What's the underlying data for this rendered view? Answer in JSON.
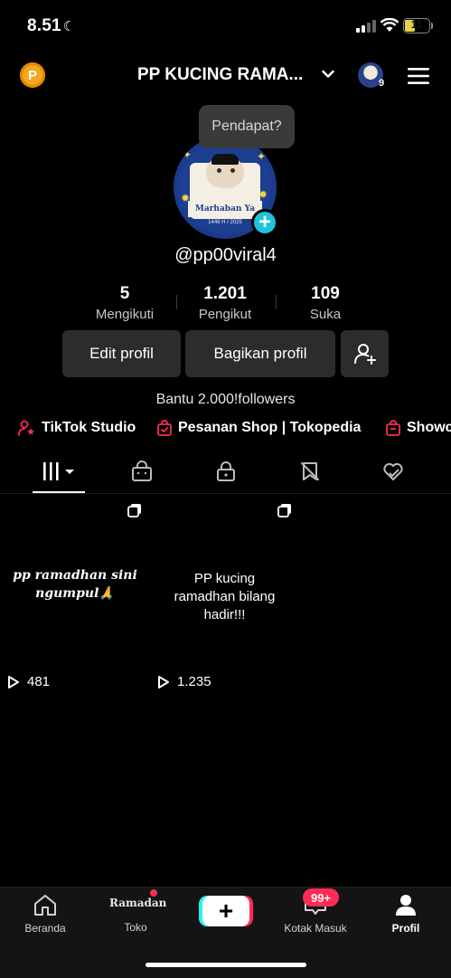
{
  "status_bar": {
    "time": "8.51",
    "battery": "11"
  },
  "header": {
    "title": "PP KUCING RAMA...",
    "coin_label": "P",
    "notification_count": "9"
  },
  "tooltip": "Pendapat?",
  "avatar": {
    "banner": "Marhaban Ya Ramadhan",
    "sub": "1446 H / 2025"
  },
  "profile": {
    "username": "@pp00viral4",
    "bio": "Bantu 2.000!followers"
  },
  "stats": [
    {
      "value": "5",
      "label": "Mengikuti"
    },
    {
      "value": "1.201",
      "label": "Pengikut"
    },
    {
      "value": "109",
      "label": "Suka"
    }
  ],
  "buttons": {
    "edit": "Edit profil",
    "share": "Bagikan profil"
  },
  "links": [
    {
      "label": "TikTok Studio",
      "icon": "person-star-icon"
    },
    {
      "label": "Pesanan Shop | Tokopedia",
      "icon": "shopping-bag-check-icon"
    },
    {
      "label": "Showcase",
      "icon": "shopping-bag-icon"
    }
  ],
  "tabs": [
    "grid-icon",
    "shop-bag-icon",
    "lock-icon",
    "repost-icon",
    "liked-icon"
  ],
  "videos": [
    {
      "caption": "pp ramadhan sini ngumpul🙏",
      "views": "481"
    },
    {
      "caption": "PP kucing ramadhan bilang hadir!!!",
      "views": "1.235"
    }
  ],
  "nav": {
    "home": "Beranda",
    "shop": "Toko",
    "shop_logo": "Ramadan",
    "inbox": "Kotak Masuk",
    "inbox_badge": "99+",
    "profile": "Profil"
  },
  "colors": {
    "accent_red": "#fe2c55",
    "accent_cyan": "#20c3d9",
    "coin": "#f5a623"
  }
}
